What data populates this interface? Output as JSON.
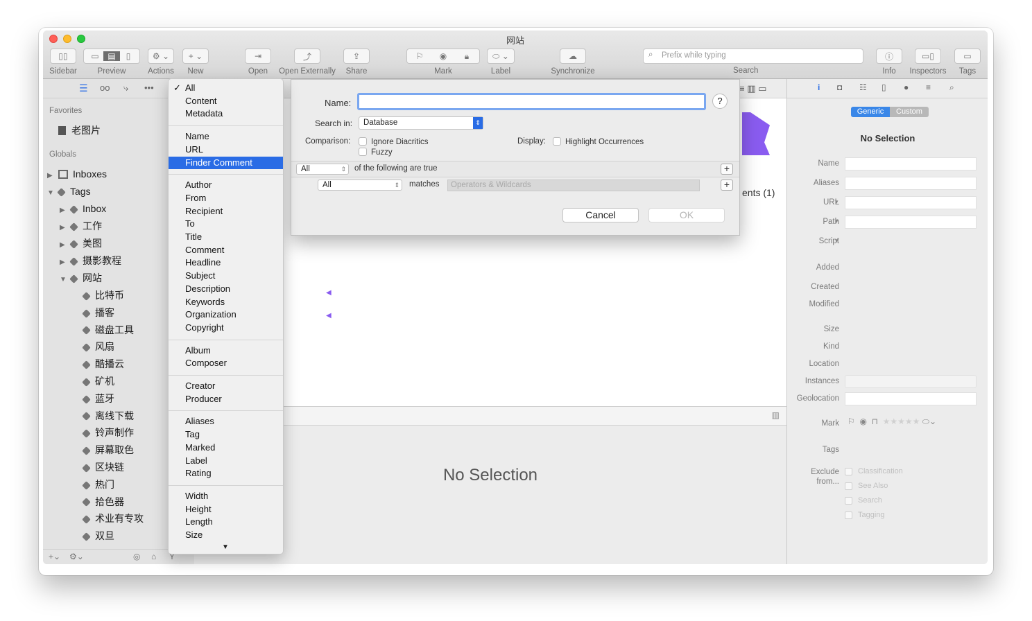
{
  "window": {
    "title": "网站"
  },
  "toolbar": {
    "sidebar": "Sidebar",
    "preview": "Preview",
    "actions": "Actions",
    "new": "New",
    "open": "Open",
    "open_externally": "Open Externally",
    "share": "Share",
    "mark": "Mark",
    "label": "Label",
    "synchronize": "Synchronize",
    "search_placeholder": "Prefix while typing",
    "search": "Search",
    "info": "Info",
    "inspectors": "Inspectors",
    "tags": "Tags"
  },
  "sidebar": {
    "favorites_header": "Favorites",
    "favorites": [
      "老图片"
    ],
    "globals_header": "Globals",
    "inboxes": "Inboxes",
    "tags": "Tags",
    "tag_groups": [
      "Inbox",
      "工作",
      "美图",
      "摄影教程",
      "网站"
    ],
    "website_children": [
      "比特币",
      "播客",
      "磁盘工具",
      "风扇",
      "酷播云",
      "矿机",
      "蓝牙",
      "离线下载",
      "铃声制作",
      "屏幕取色",
      "区块链",
      "热门",
      "拾色器",
      "术业有专攻",
      "双旦"
    ]
  },
  "menu": {
    "groups": [
      [
        "All",
        "Content",
        "Metadata"
      ],
      [
        "Name",
        "URL",
        "Finder Comment"
      ],
      [
        "Author",
        "From",
        "Recipient",
        "To",
        "Title",
        "Comment",
        "Headline",
        "Subject",
        "Description",
        "Keywords",
        "Organization",
        "Copyright"
      ],
      [
        "Album",
        "Composer"
      ],
      [
        "Creator",
        "Producer"
      ],
      [
        "Aliases",
        "Tag",
        "Marked",
        "Label",
        "Rating"
      ],
      [
        "Width",
        "Height",
        "Length",
        "Size"
      ]
    ],
    "checked": "All",
    "highlighted": "Finder Comment"
  },
  "dialog": {
    "name_label": "Name:",
    "name_value": "",
    "help": "?",
    "search_in_label": "Search in:",
    "search_in_value": "Database",
    "comparison_label": "Comparison:",
    "ignore_diacritics": "Ignore Diacritics",
    "fuzzy": "Fuzzy",
    "display_label": "Display:",
    "highlight_occurrences": "Highlight Occurrences",
    "match_mode": "All",
    "following_text": "of the following are true",
    "criterion_field": "All",
    "criterion_operator": "matches",
    "criterion_placeholder": "Operators & Wildcards",
    "cancel": "Cancel",
    "ok": "OK"
  },
  "center": {
    "partial_text": "ents (1)",
    "no_selection": "No Selection"
  },
  "inspector": {
    "seg_generic": "Generic",
    "seg_custom": "Custom",
    "title": "No Selection",
    "labels": {
      "name": "Name",
      "aliases": "Aliases",
      "url": "URL",
      "path": "Path",
      "script": "Script",
      "added": "Added",
      "created": "Created",
      "modified": "Modified",
      "size": "Size",
      "kind": "Kind",
      "location": "Location",
      "instances": "Instances",
      "geolocation": "Geolocation",
      "mark": "Mark",
      "tags": "Tags",
      "exclude": "Exclude",
      "exclude_from": "from..."
    },
    "exclude_options": [
      "Classification",
      "See Also",
      "Search",
      "Tagging"
    ]
  },
  "colors": {
    "accent": "#2a6ce5",
    "selection_seg": "#3a87e8",
    "purple_shape": "#8a5cf0"
  }
}
